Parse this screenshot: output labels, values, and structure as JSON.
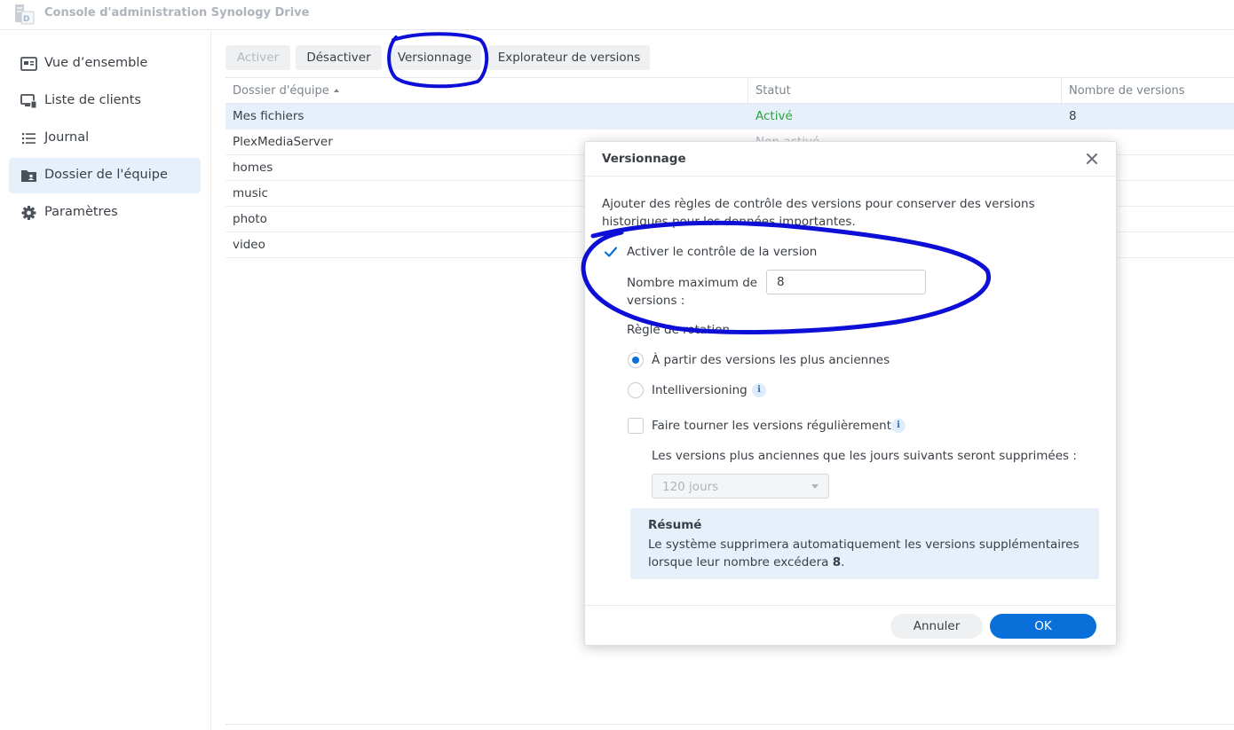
{
  "app": {
    "title": "Console d'administration Synology Drive",
    "icon": "synology-drive-icon"
  },
  "sidebar": {
    "items": [
      {
        "label": "Vue d’ensemble",
        "icon": "overview-icon"
      },
      {
        "label": "Liste de clients",
        "icon": "client-list-icon"
      },
      {
        "label": "Journal",
        "icon": "log-list-icon"
      },
      {
        "label": "Dossier de l'équipe",
        "icon": "team-folder-icon",
        "active": true
      },
      {
        "label": "Paramètres",
        "icon": "gear-icon"
      }
    ]
  },
  "toolbar": {
    "activate_label": "Activer",
    "deactivate_label": "Désactiver",
    "versioning_label": "Versionnage",
    "version_explorer_label": "Explorateur de versions"
  },
  "grid": {
    "columns": [
      "Dossier d'équipe",
      "Statut",
      "Nombre de versions"
    ],
    "rows": [
      {
        "name": "Mes fichiers",
        "status": "Activé",
        "versions": "8"
      },
      {
        "name": "PlexMediaServer",
        "status": "Non activé",
        "versions": ""
      },
      {
        "name": "homes",
        "status": "",
        "versions": ""
      },
      {
        "name": "music",
        "status": "",
        "versions": ""
      },
      {
        "name": "photo",
        "status": "",
        "versions": ""
      },
      {
        "name": "video",
        "status": "",
        "versions": ""
      }
    ]
  },
  "modal": {
    "title": "Versionnage",
    "description": "Ajouter des règles de contrôle des versions pour conserver des versions historiques pour les données importantes.",
    "enable_label": "Activer le contrôle de la version",
    "max_versions_label": "Nombre maximum de versions :",
    "max_versions_value": "8",
    "rotation_rule_label": "Règle de rotation",
    "rotation_oldest_label": "À partir des versions les plus anciennes",
    "rotation_intelli_label": "Intelliversioning",
    "rotate_regularly_label": "Faire tourner les versions régulièrement",
    "days_label": "Les versions plus anciennes que les jours suivants seront supprimées :",
    "days_value": "120 jours",
    "summary_title": "Résumé",
    "summary_text_prefix": "Le système supprimera automatiquement les versions supplémentaires lorsque leur nombre excédera ",
    "summary_count": "8",
    "summary_text_suffix": ".",
    "cancel_label": "Annuler",
    "ok_label": "OK"
  },
  "colors": {
    "accent": "#0870d8",
    "active_status": "#2ba33a",
    "selection": "#e5f0fb",
    "annotation_ink": "#0d0fd6"
  }
}
